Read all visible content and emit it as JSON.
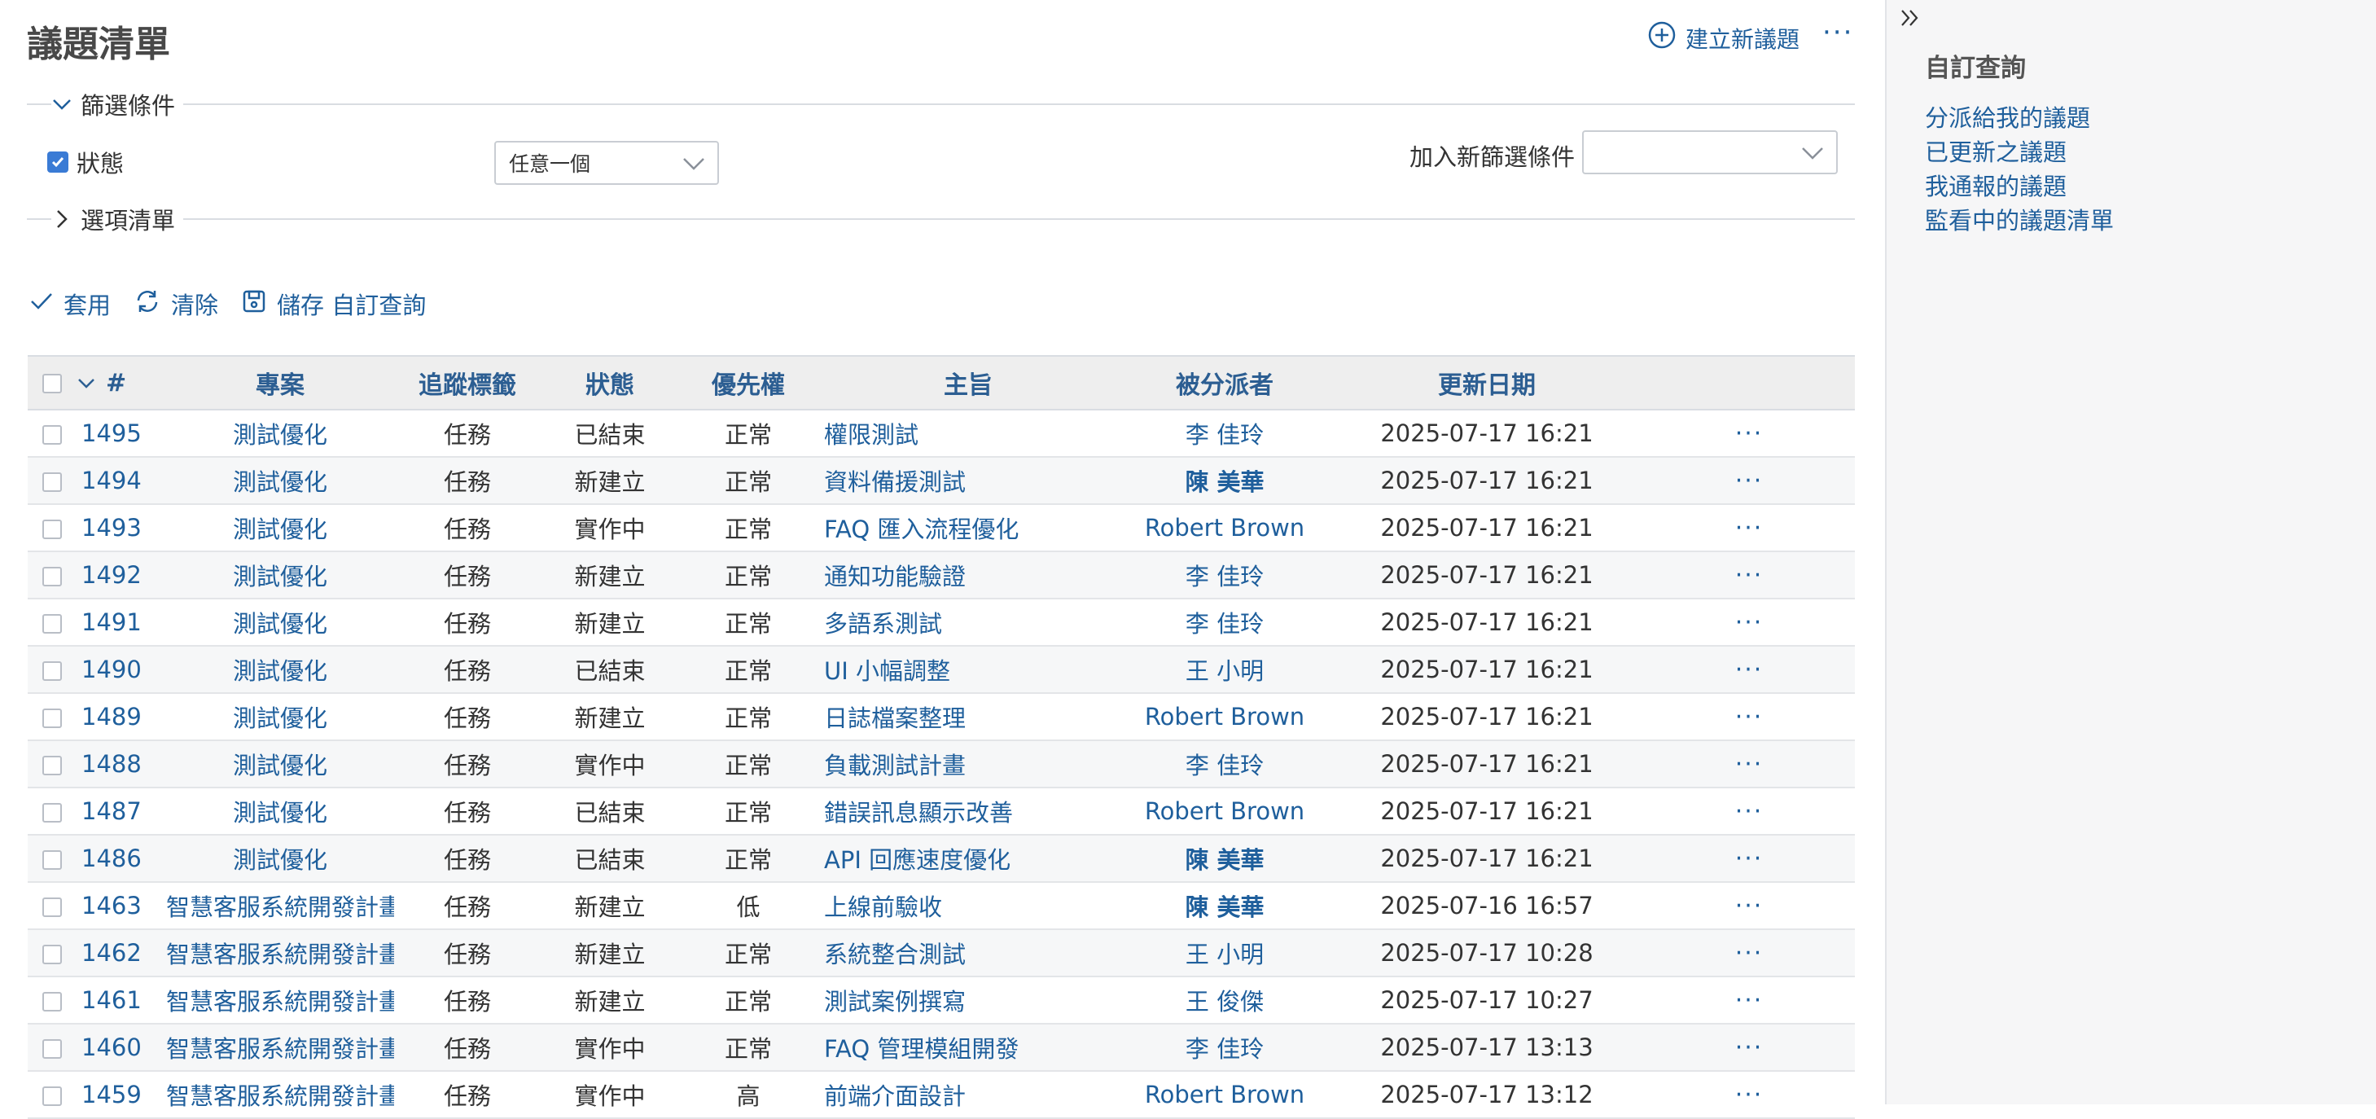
{
  "header": {
    "title": "議題清單",
    "new_issue": "建立新議題",
    "more": "···"
  },
  "filters": {
    "legend": "篩選條件",
    "status_label": "狀態",
    "status_operator": "任意一個",
    "add_filter_label": "加入新篩選條件",
    "add_filter_value": ""
  },
  "options": {
    "legend": "選項清單"
  },
  "actions": {
    "apply": "套用",
    "clear": "清除",
    "save": "儲存 自訂查詢"
  },
  "table": {
    "columns": {
      "id": "#",
      "project": "專案",
      "tracker": "追蹤標籤",
      "status": "狀態",
      "priority": "優先權",
      "subject": "主旨",
      "assignee": "被分派者",
      "updated": "更新日期"
    },
    "rows": [
      {
        "id": "1495",
        "project": "測試優化",
        "tracker": "任務",
        "status": "已結束",
        "priority": "正常",
        "subject": "權限測試",
        "assignee": "李 佳玲",
        "updated": "2025-07-17 16:21"
      },
      {
        "id": "1494",
        "project": "測試優化",
        "tracker": "任務",
        "status": "新建立",
        "priority": "正常",
        "subject": "資料備援測試",
        "assignee": "陳 美華",
        "updated": "2025-07-17 16:21"
      },
      {
        "id": "1493",
        "project": "測試優化",
        "tracker": "任務",
        "status": "實作中",
        "priority": "正常",
        "subject": "FAQ 匯入流程優化",
        "assignee": "Robert Brown",
        "updated": "2025-07-17 16:21"
      },
      {
        "id": "1492",
        "project": "測試優化",
        "tracker": "任務",
        "status": "新建立",
        "priority": "正常",
        "subject": "通知功能驗證",
        "assignee": "李 佳玲",
        "updated": "2025-07-17 16:21"
      },
      {
        "id": "1491",
        "project": "測試優化",
        "tracker": "任務",
        "status": "新建立",
        "priority": "正常",
        "subject": "多語系測試",
        "assignee": "李 佳玲",
        "updated": "2025-07-17 16:21"
      },
      {
        "id": "1490",
        "project": "測試優化",
        "tracker": "任務",
        "status": "已結束",
        "priority": "正常",
        "subject": "UI 小幅調整",
        "assignee": "王 小明",
        "updated": "2025-07-17 16:21"
      },
      {
        "id": "1489",
        "project": "測試優化",
        "tracker": "任務",
        "status": "新建立",
        "priority": "正常",
        "subject": "日誌檔案整理",
        "assignee": "Robert Brown",
        "updated": "2025-07-17 16:21"
      },
      {
        "id": "1488",
        "project": "測試優化",
        "tracker": "任務",
        "status": "實作中",
        "priority": "正常",
        "subject": "負載測試計畫",
        "assignee": "李 佳玲",
        "updated": "2025-07-17 16:21"
      },
      {
        "id": "1487",
        "project": "測試優化",
        "tracker": "任務",
        "status": "已結束",
        "priority": "正常",
        "subject": "錯誤訊息顯示改善",
        "assignee": "Robert Brown",
        "updated": "2025-07-17 16:21"
      },
      {
        "id": "1486",
        "project": "測試優化",
        "tracker": "任務",
        "status": "已結束",
        "priority": "正常",
        "subject": "API 回應速度優化",
        "assignee": "陳 美華",
        "updated": "2025-07-17 16:21"
      },
      {
        "id": "1463",
        "project": "智慧客服系統開發計畫",
        "tracker": "任務",
        "status": "新建立",
        "priority": "低",
        "subject": "上線前驗收",
        "assignee": "陳 美華",
        "updated": "2025-07-16 16:57"
      },
      {
        "id": "1462",
        "project": "智慧客服系統開發計畫",
        "tracker": "任務",
        "status": "新建立",
        "priority": "正常",
        "subject": "系統整合測試",
        "assignee": "王 小明",
        "updated": "2025-07-17 10:28"
      },
      {
        "id": "1461",
        "project": "智慧客服系統開發計畫",
        "tracker": "任務",
        "status": "新建立",
        "priority": "正常",
        "subject": "測試案例撰寫",
        "assignee": "王 俊傑",
        "updated": "2025-07-17 10:27"
      },
      {
        "id": "1460",
        "project": "智慧客服系統開發計畫",
        "tracker": "任務",
        "status": "實作中",
        "priority": "正常",
        "subject": "FAQ 管理模組開發",
        "assignee": "李 佳玲",
        "updated": "2025-07-17 13:13"
      },
      {
        "id": "1459",
        "project": "智慧客服系統開發計畫",
        "tracker": "任務",
        "status": "實作中",
        "priority": "高",
        "subject": "前端介面設計",
        "assignee": "Robert Brown",
        "updated": "2025-07-17 13:12"
      }
    ]
  },
  "sidebar": {
    "title": "自訂查詢",
    "links": [
      "分派給我的議題",
      "已更新之議題",
      "我通報的議題",
      "監看中的議題清單"
    ]
  },
  "colors": {
    "link": "#1f5f9c",
    "header_bg": "#eeeeee",
    "sidebar_bg": "#f6f6f7",
    "checkbox": "#3a7bd5"
  }
}
